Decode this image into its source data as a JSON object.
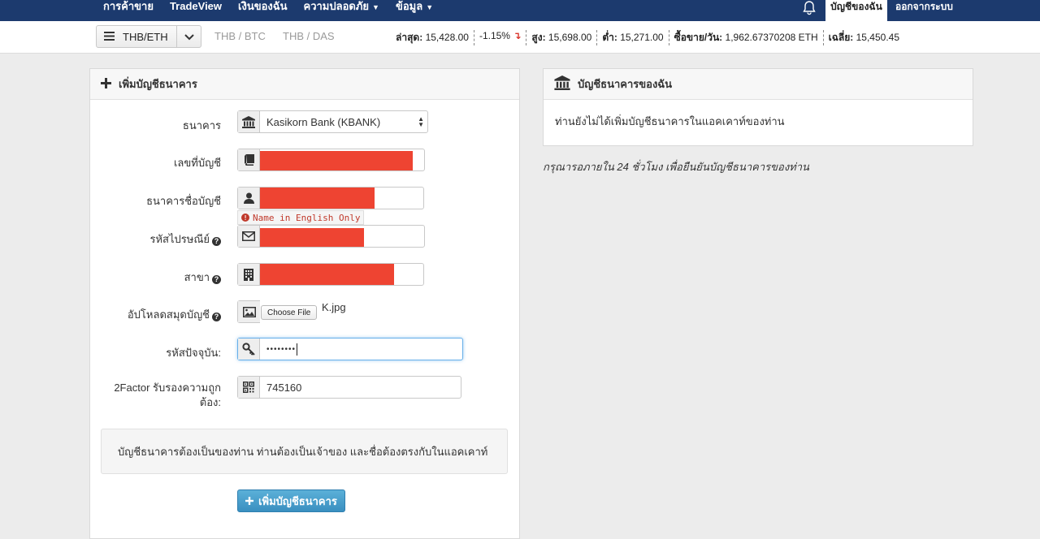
{
  "nav": {
    "items": [
      {
        "label": "การค้าขาย",
        "caret": false
      },
      {
        "label": "TradeView",
        "caret": false
      },
      {
        "label": "เงินของฉัน",
        "caret": false
      },
      {
        "label": "ความปลอดภัย",
        "caret": true
      },
      {
        "label": "ข้อมูล",
        "caret": true
      }
    ],
    "account_label": "บัญชีของฉัน",
    "logout_label": "ออกจากระบบ"
  },
  "pairbar": {
    "selected_pair": "THB/ETH",
    "other_pairs": [
      "THB / BTC",
      "THB / DAS"
    ],
    "ticker": {
      "last_label": "ล่าสุด:",
      "last_value": "15,428.00",
      "change": "-1.15%",
      "high_label": "สูง:",
      "high_value": "15,698.00",
      "low_label": "ต่ำ:",
      "low_value": "15,271.00",
      "volume_label": "ซื้อขาย/วัน:",
      "volume_value": "1,962.67370208 ETH",
      "avg_label": "เฉลี่ย:",
      "avg_value": "15,450.45"
    }
  },
  "form": {
    "title": "เพิ่มบัญชีธนาคาร",
    "bank_label": "ธนาคาร",
    "bank_value": "Kasikorn Bank (KBANK)",
    "account_no_label": "เลขที่บัญชี",
    "account_name_label": "ธนาคารชื่อบัญชี",
    "name_hint": "Name in English Only",
    "postcode_label": "รหัสไปรษณีย์",
    "branch_label": "สาขา",
    "upload_label": "อัปโหลดสมุดบัญชี",
    "choose_file": "Choose File",
    "file_name": "K.jpg",
    "password_label": "รหัสปัจจุบัน:",
    "password_value": "••••••••",
    "twofactor_label_1": "2Factor รับรองความถูก",
    "twofactor_label_2": "ต้อง:",
    "twofactor_value": "745160",
    "notice": "บัญชีธนาคารต้องเป็นของท่าน ท่านต้องเป็นเจ้าของ และชื่อต้องตรงกับในแอคเคาท์",
    "submit_label": "เพิ่มบัญชีธนาคาร"
  },
  "my_accounts": {
    "title": "บัญชีธนาคารของฉัน",
    "empty_text": "ท่านยังไม่ได้เพิ่มบัญชีธนาคารในแอคเคาท์ของท่าน",
    "note": "กรุณารอภายใน 24 ชั่วโมง เพื่อยืนยันบัญชีธนาคารของท่าน"
  },
  "colors": {
    "nav_bg": "#1c3a6e",
    "redaction": "#ee4432",
    "button": "#3a8fc0",
    "change_down": "#d9342b"
  }
}
